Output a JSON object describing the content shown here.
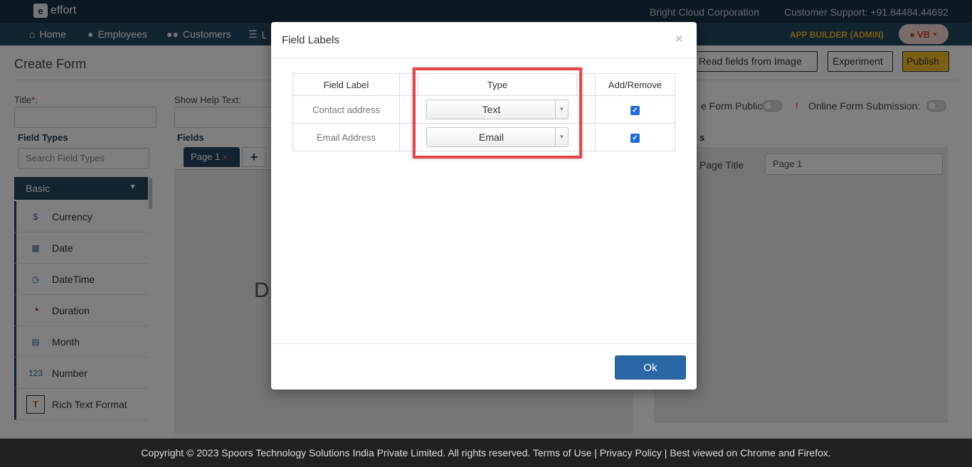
{
  "topbar": {
    "logo_text": "effort",
    "company": "Bright Cloud Corporation",
    "support": "Customer Support: +91.84484.44692"
  },
  "nav": {
    "items": [
      {
        "label": "Home",
        "icon": "home-icon"
      },
      {
        "label": "Employees",
        "icon": "user-icon"
      },
      {
        "label": "Customers",
        "icon": "users-icon"
      },
      {
        "label": "L",
        "icon": "list-icon"
      }
    ],
    "role": "APP BUILDER (ADMIN)",
    "user_initials": "VB"
  },
  "page": {
    "title": "Create Form",
    "title_label": "Title",
    "title_required": "*",
    "title_colon": ":",
    "help_label": "Show Help Text:",
    "field_types_label": "Field Types",
    "fields_label": "Fields",
    "search_placeholder": "Search Field Types",
    "group_label": "Basic",
    "page_tab": "Page 1",
    "page_tab_close": "x",
    "add_tab": "+",
    "canvas_letter": "D",
    "field_types": [
      {
        "label": "Currency",
        "icon": "currency-icon"
      },
      {
        "label": "Date",
        "icon": "calendar-icon"
      },
      {
        "label": "DateTime",
        "icon": "datetime-icon"
      },
      {
        "label": "Duration",
        "icon": "duration-icon"
      },
      {
        "label": "Month",
        "icon": "month-icon"
      },
      {
        "label": "Number",
        "icon": "number-icon"
      },
      {
        "label": "Rich Text Format",
        "icon": "rich-text-icon"
      }
    ],
    "read_fields_button": "Read fields from Image",
    "experiment_button": "Experiment",
    "publish_button": "Publish",
    "form_public_label": "e Form Public:",
    "online_submission_label": "Online Form Submission:",
    "right_section_label": "s",
    "page_title_label": "Page Title",
    "page_title_value": "Page 1"
  },
  "footer": {
    "text": "Copyright © 2023 Spoors Technology Solutions India Private Limited. All rights reserved. Terms of Use | Privacy Policy | Best viewed on Chrome and Firefox."
  },
  "modal": {
    "title": "Field Labels",
    "close": "×",
    "columns": [
      "Field Label",
      "",
      "Type",
      "",
      "Add/Remove"
    ],
    "rows": [
      {
        "label": "Contact address",
        "type": "Text",
        "checked": true
      },
      {
        "label": "Email Address",
        "type": "Email",
        "checked": true
      }
    ],
    "ok_button": "Ok",
    "highlight_color": "#e8444a"
  },
  "colors": {
    "topbar": "#1b3446",
    "navbar": "#24485f",
    "accent": "#2a67a6",
    "publish": "#f5c02a",
    "role": "#f0b429"
  }
}
